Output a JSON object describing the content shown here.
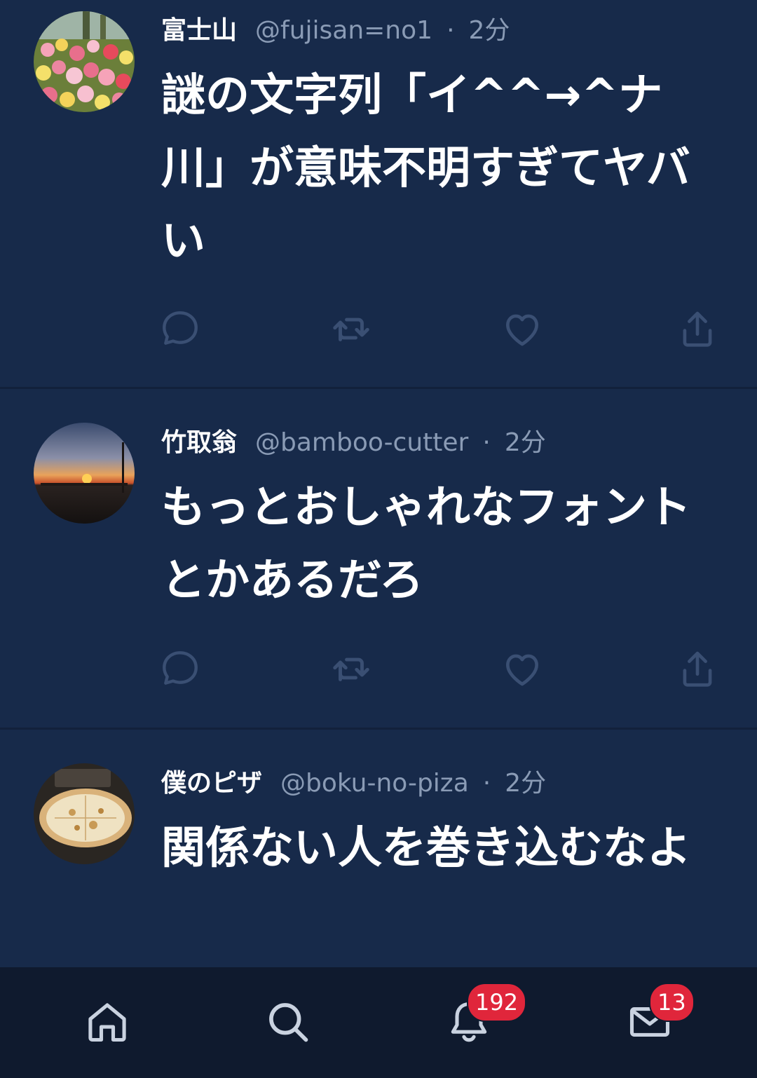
{
  "colors": {
    "background": "#172a4a",
    "tabbar": "#0f1a2e",
    "muted": "#8a9bb5",
    "badge": "#e0263b"
  },
  "tweets": [
    {
      "display_name": "富士山",
      "handle": "@fujisan=no1",
      "separator": "·",
      "time": "2分",
      "text": "謎の文字列「イ^^→^ナ川」が意味不明すぎてヤバい",
      "avatar": "tulip-field-avatar"
    },
    {
      "display_name": "竹取翁",
      "handle": "@bamboo-cutter",
      "separator": "·",
      "time": "2分",
      "text": "もっとおしゃれなフォントとかあるだろ",
      "avatar": "sunset-avatar"
    },
    {
      "display_name": "僕のピザ",
      "handle": "@boku-no-piza",
      "separator": "·",
      "time": "2分",
      "text": "関係ない人を巻き込むなよ",
      "avatar": "pizza-avatar"
    }
  ],
  "actions": [
    "reply-icon",
    "retweet-icon",
    "like-icon",
    "share-icon"
  ],
  "tabbar": {
    "tabs": [
      "home-icon",
      "search-icon",
      "bell-icon",
      "mail-icon"
    ],
    "notifications_badge": "192",
    "messages_badge": "13"
  }
}
